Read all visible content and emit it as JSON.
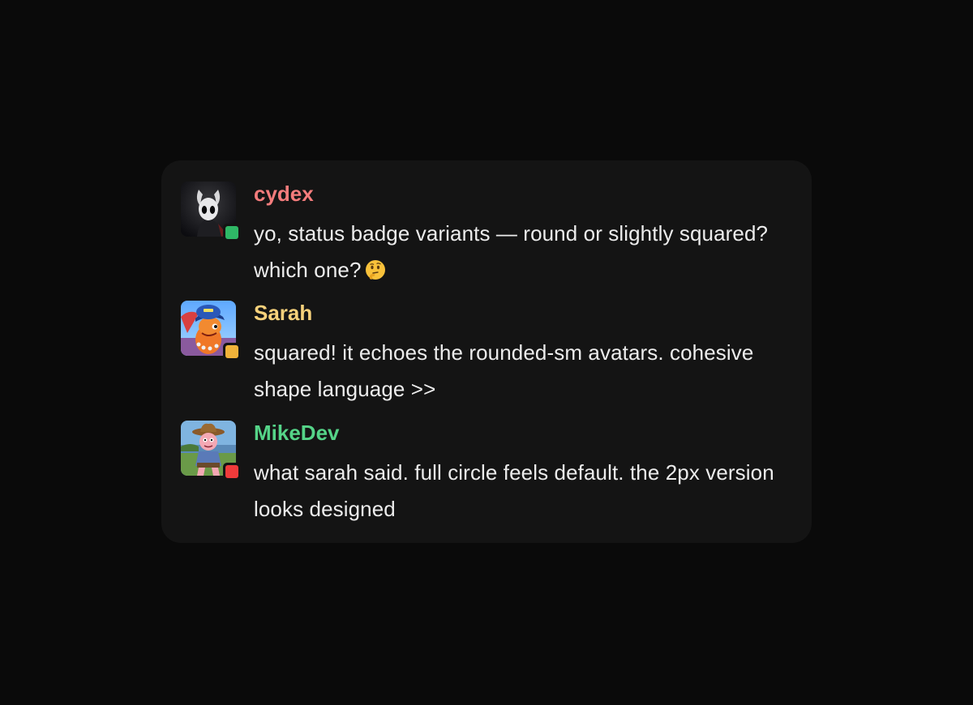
{
  "colors": {
    "background": "#0a0a0a",
    "card": "#141414",
    "text": "#ececec"
  },
  "messages": [
    {
      "username": "cydex",
      "name_color": "#f47c7c",
      "text": "yo, status badge variants — round or slightly squared? which one?",
      "emoji": "thinking-face",
      "avatar": "hollow-knight-character-avatar",
      "status": "online",
      "status_color": "#2fb866"
    },
    {
      "username": "Sarah",
      "name_color": "#f6d17b",
      "text": "squared! it echoes the rounded-sm avatars. cohesive shape language >>",
      "emoji": "",
      "avatar": "cartoon-dino-with-cap-avatar",
      "status": "idle",
      "status_color": "#f0b23a"
    },
    {
      "username": "MikeDev",
      "name_color": "#55d488",
      "text": "what sarah said. full circle feels default. the 2px version looks designed",
      "emoji": "",
      "avatar": "cowboy-cartoon-avatar",
      "status": "busy",
      "status_color": "#ee3b3b"
    }
  ]
}
